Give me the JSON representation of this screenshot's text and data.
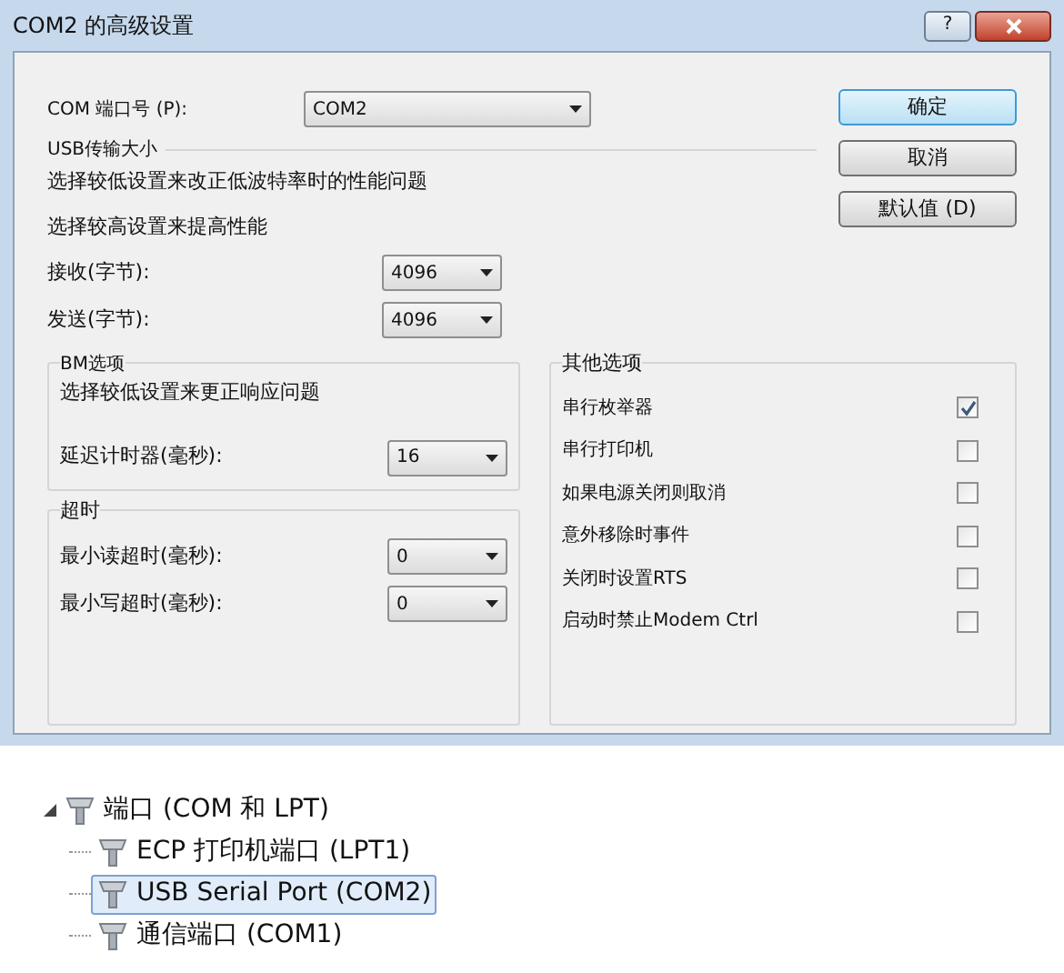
{
  "window": {
    "title": "COM2 的高级设置",
    "help_button": "?"
  },
  "port": {
    "label": "COM 端口号 (P):",
    "value": "COM2"
  },
  "usb": {
    "title": "USB传输大小",
    "notes": [
      "选择较低设置来改正低波特率时的性能问题",
      "选择较高设置来提高性能"
    ],
    "fields": [
      {
        "label": "接收(字节):",
        "value": "4096"
      },
      {
        "label": "发送(字节):",
        "value": "4096"
      }
    ]
  },
  "bm": {
    "title": "BM选项",
    "note": "选择较低设置来更正响应问题",
    "field": {
      "label": "延迟计时器(毫秒):",
      "value": "16"
    }
  },
  "timeout": {
    "title": "超时",
    "fields": [
      {
        "label": "最小读超时(毫秒):",
        "value": "0"
      },
      {
        "label": "最小写超时(毫秒):",
        "value": "0"
      }
    ]
  },
  "other": {
    "title": "其他选项",
    "options": [
      {
        "label": "串行枚举器",
        "checked": true
      },
      {
        "label": "串行打印机",
        "checked": false
      },
      {
        "label": "如果电源关闭则取消",
        "checked": false
      },
      {
        "label": "意外移除时事件",
        "checked": false
      },
      {
        "label": "关闭时设置RTS",
        "checked": false
      },
      {
        "label": "启动时禁止Modem Ctrl",
        "checked": false
      }
    ]
  },
  "buttons": [
    {
      "label": "确定",
      "default": true
    },
    {
      "label": "取消",
      "default": false
    },
    {
      "label": "默认值 (D)",
      "default": false
    }
  ],
  "tree": {
    "label": "端口 (COM 和 LPT)",
    "expanded": true,
    "children": [
      {
        "label": "ECP 打印机端口 (LPT1)",
        "selected": false
      },
      {
        "label": "USB Serial Port (COM2)",
        "selected": true
      },
      {
        "label": "通信端口 (COM1)",
        "selected": false
      }
    ]
  }
}
